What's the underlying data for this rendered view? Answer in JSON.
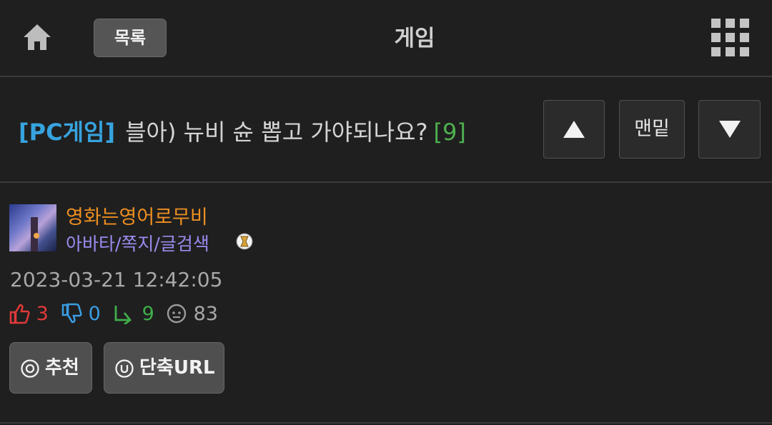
{
  "header": {
    "list_label": "목록",
    "title": "게임",
    "icons": {
      "home": "home-icon",
      "menu": "grid-menu-icon"
    }
  },
  "post": {
    "category": "[PC게임]",
    "title": "블아) 뉴비 슌 뽑고 가야되나요?",
    "comment_count": "[9]",
    "nav": {
      "up": "▲",
      "bottom": "맨밑",
      "down": "▼"
    }
  },
  "author": {
    "nickname": "영화는영어로무비",
    "links": "아바타/쪽지/글검색"
  },
  "meta": {
    "datetime": "2023-03-21 12:42:05",
    "upvotes": "3",
    "downvotes": "0",
    "replies": "9",
    "views": "83"
  },
  "actions": {
    "recommend": "추천",
    "short_url": "단축URL"
  },
  "colors": {
    "background": "#1f1f1f",
    "category": "#37a3de",
    "comment_count": "#4fb04f",
    "nickname": "#ee8f22",
    "links": "#9a8cf0",
    "upvote": "#e13a3a",
    "downvote": "#3a9ee4",
    "reply": "#3fae4a"
  }
}
